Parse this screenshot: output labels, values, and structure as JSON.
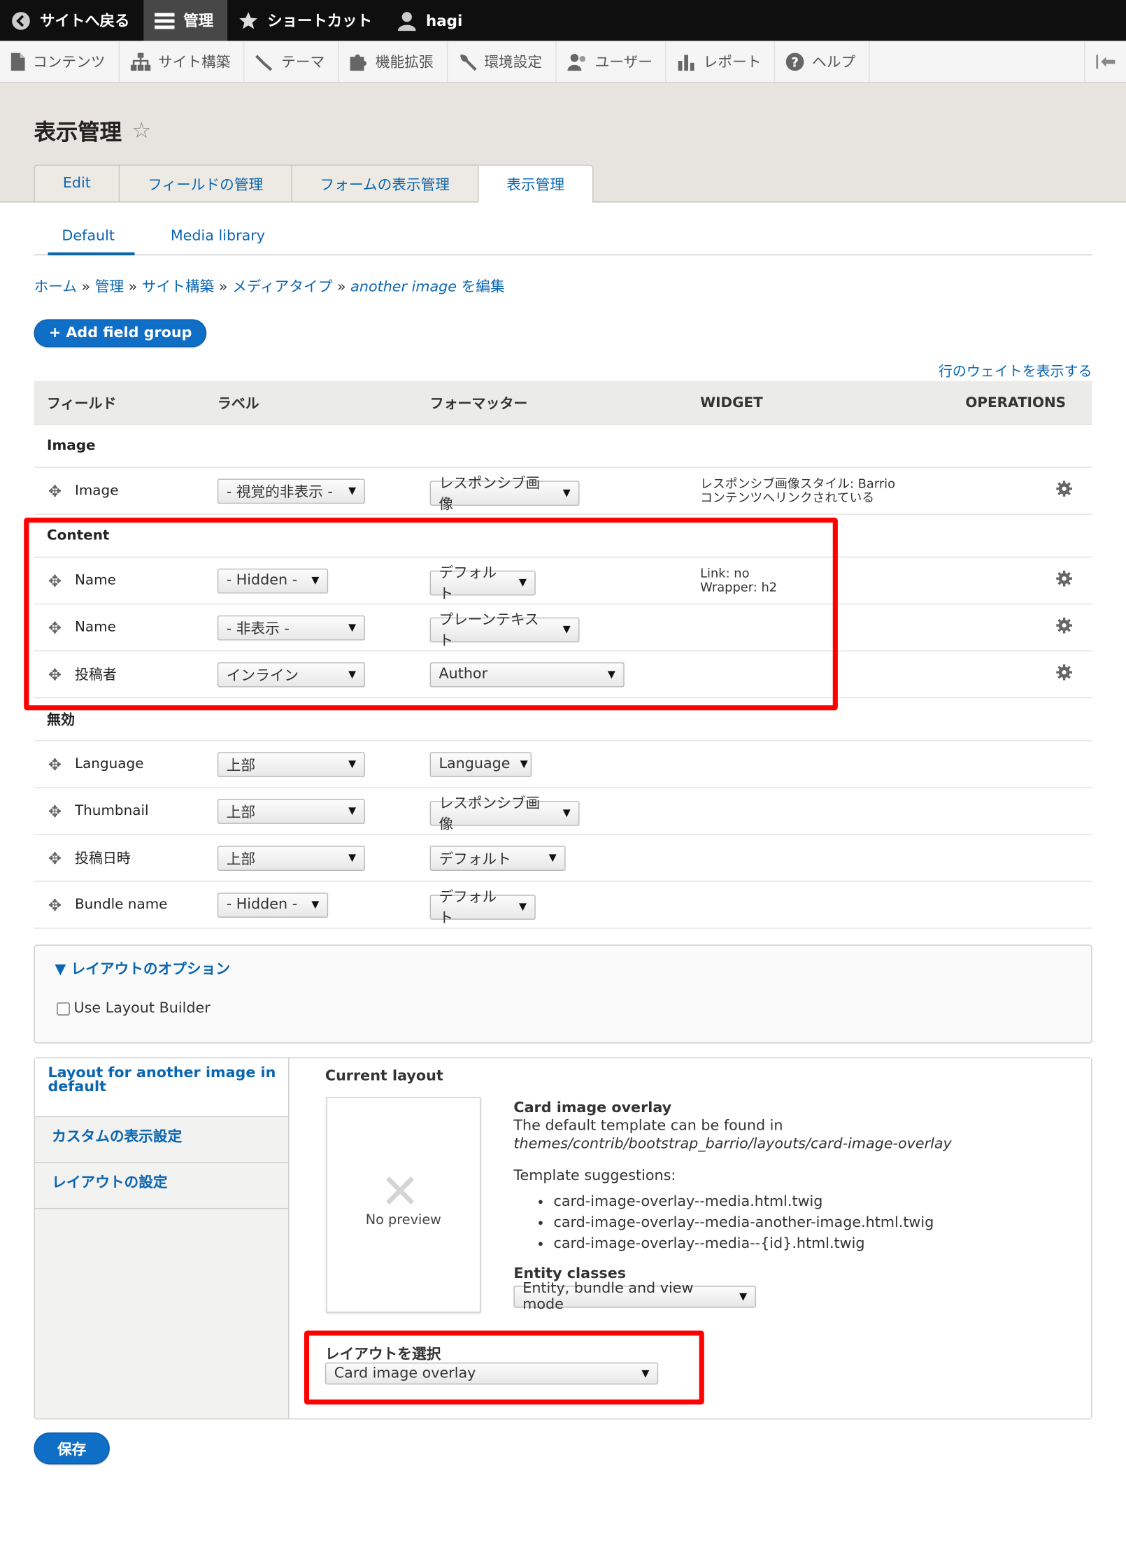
{
  "toolbar": {
    "back": "サイトへ戻る",
    "manage": "管理",
    "shortcuts": "ショートカット",
    "user": "hagi"
  },
  "tray": {
    "items": [
      "コンテンツ",
      "サイト構築",
      "テーマ",
      "機能拡張",
      "環境設定",
      "ユーザー",
      "レポート",
      "ヘルプ"
    ]
  },
  "page": {
    "title": "表示管理",
    "tabs": [
      "Edit",
      "フィールドの管理",
      "フォームの表示管理",
      "表示管理"
    ],
    "sub_tabs": [
      "Default",
      "Media library"
    ]
  },
  "breadcrumb": {
    "home": "ホーム",
    "admin": "管理",
    "structure": "サイト構築",
    "media_types": "メディアタイプ",
    "current_italic": "another image",
    "current_suffix": " を編集"
  },
  "add_field_group": "+ Add field group",
  "row_weights": "行のウェイトを表示する",
  "table": {
    "headers": [
      "フィールド",
      "ラベル",
      "フォーマッター",
      "WIDGET",
      "OPERATIONS"
    ],
    "regions": {
      "image": "Image",
      "content": "Content",
      "disabled": "無効"
    },
    "rows": [
      {
        "name": "Image",
        "label": "- 視覚的非表示 -",
        "formatter": "レスポンシブ画像",
        "widget1": "レスポンシブ画像スタイル: Barrio",
        "widget2": "コンテンツへリンクされている"
      },
      {
        "name": "Name",
        "label": "- Hidden -",
        "formatter": "デフォルト",
        "widget1": "Link: no",
        "widget2": "Wrapper: h2"
      },
      {
        "name": "Name",
        "label": "- 非表示 -",
        "formatter": "プレーンテキスト"
      },
      {
        "name": "投稿者",
        "label": "インライン",
        "formatter": "Author"
      },
      {
        "name": "Language",
        "label": "上部",
        "formatter": "Language"
      },
      {
        "name": "Thumbnail",
        "label": "上部",
        "formatter": "レスポンシブ画像"
      },
      {
        "name": "投稿日時",
        "label": "上部",
        "formatter": "デフォルト"
      },
      {
        "name": "Bundle name",
        "label": "- Hidden -",
        "formatter": "デフォルト"
      }
    ]
  },
  "layout_options": {
    "legend": "レイアウトのオプション",
    "use_layout_builder": "Use Layout Builder"
  },
  "vtabs": {
    "items": [
      "Layout for another image in default",
      "カスタムの表示設定",
      "レイアウトの設定"
    ],
    "current_layout": "Current layout",
    "no_preview": "No preview",
    "layout_name": "Card image overlay",
    "template_intro": "The default template can be found in",
    "template_path": "themes/contrib/bootstrap_barrio/layouts/card-image-overlay",
    "suggestions_label": "Template suggestions:",
    "suggestions": [
      "card-image-overlay--media.html.twig",
      "card-image-overlay--media-another-image.html.twig",
      "card-image-overlay--media--{id}.html.twig"
    ],
    "entity_classes_label": "Entity classes",
    "entity_classes_value": "Entity, bundle and view mode",
    "select_layout_label": "レイアウトを選択",
    "select_layout_value": "Card image overlay"
  },
  "save": "保存",
  "colors": {
    "link": "#0b66b1",
    "primary_button": "#0f6ec6",
    "highlight": "#ff0000"
  }
}
